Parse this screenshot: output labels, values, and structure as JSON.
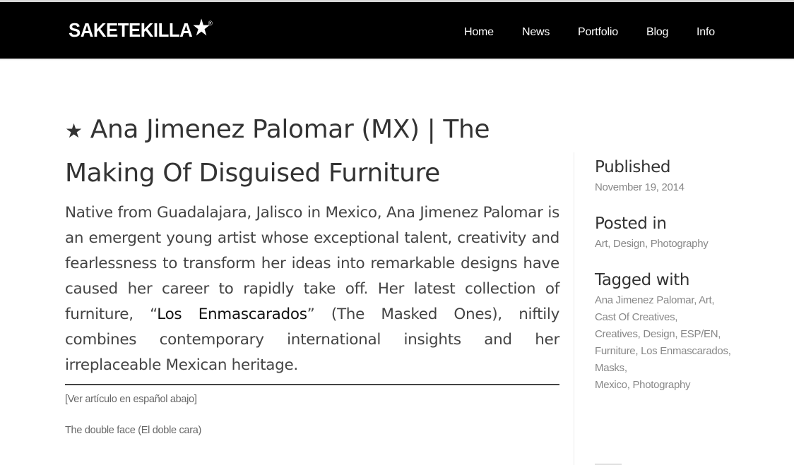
{
  "site": {
    "logo_text": "SAKETEKILLA",
    "logo_star": "★",
    "logo_reg": "®"
  },
  "nav": {
    "items": [
      {
        "label": "Home"
      },
      {
        "label": "News"
      },
      {
        "label": "Portfolio"
      },
      {
        "label": "Blog"
      },
      {
        "label": "Info"
      }
    ]
  },
  "article": {
    "title_star": "★",
    "title": "Ana Jimenez Palomar (MX) | The Making Of Disguised Furniture",
    "lead_part1": "Native from Guadalajara, Jalisco in Mexico, Ana Jimenez Palomar is an emergent young artist whose exceptional talent, creativity and fearlessness to transform her ideas into remarkable designs have caused her career to rapidly take off. Her latest collection of furniture, “",
    "lead_link": "Los Enmascarados",
    "lead_part2": "” (The Masked Ones), niftily combines contemporary international insights and her irreplaceable Mexican heritage.",
    "spanish_note": "[Ver artículo en español abajo]",
    "subheading": "The double face (El doble cara)"
  },
  "sidebar": {
    "published_heading": "Published",
    "published_date": "November 19, 2014",
    "posted_heading": "Posted in",
    "categories": [
      "Art",
      "Design",
      "Photography"
    ],
    "tagged_heading": "Tagged with",
    "tags": [
      "Ana Jimenez Palomar",
      "Art",
      "Cast Of Creatives",
      "Creatives",
      "Design",
      "ESP/EN",
      "Furniture",
      "Los Enmascarados",
      "Masks",
      "Mexico",
      "Photography"
    ]
  }
}
